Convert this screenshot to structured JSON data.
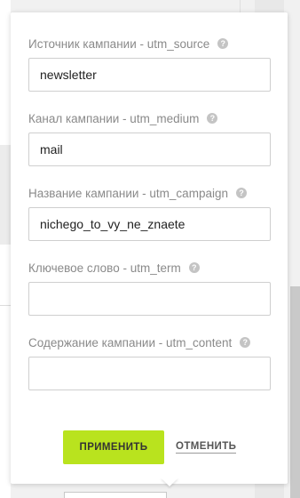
{
  "utm_form": {
    "fields": [
      {
        "label": "Источник кампании - utm_source",
        "value": "newsletter",
        "help_icon": "question-circle-icon"
      },
      {
        "label": "Канал кампании - utm_medium",
        "value": "mail",
        "help_icon": "question-circle-icon"
      },
      {
        "label": "Название кампании - utm_campaign",
        "value": "nichego_to_vy_ne_znaete",
        "help_icon": "question-circle-icon"
      },
      {
        "label": "Ключевое слово - utm_term",
        "value": "",
        "help_icon": "question-circle-icon"
      },
      {
        "label": "Содержание кампании - utm_content",
        "value": "",
        "help_icon": "question-circle-icon"
      }
    ],
    "help_glyph": "?",
    "apply_label": "ПРИМЕНИТЬ",
    "cancel_label": "ОТМЕНИТЬ"
  },
  "colors": {
    "accent": "#b9e31e",
    "label": "#8a8a8a",
    "input_border": "#cfcfcf",
    "help_icon": "#c4c4c4"
  }
}
